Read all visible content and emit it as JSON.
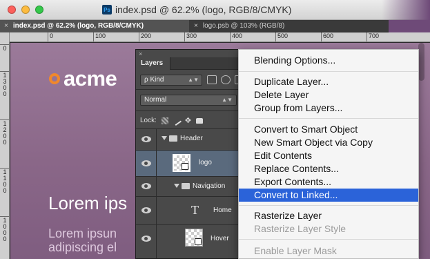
{
  "window": {
    "title": "index.psd @ 62.2% (logo, RGB/8/CMYK)",
    "app_icon": "Ps"
  },
  "tabs": [
    {
      "close": "×",
      "label": "index.psd @ 62.2% (logo, RGB/8/CMYK)",
      "active": true
    },
    {
      "close": "×",
      "label": "logo.psb @ 103% (RGB/8)",
      "active": false
    }
  ],
  "ruler": {
    "top": [
      "0",
      "100",
      "200",
      "300",
      "400",
      "500",
      "600",
      "700"
    ],
    "left": [
      "0",
      "1\n3\n0\n0",
      "1\n2\n0\n0",
      "1\n1\n0\n0",
      "1\n0\n0\n0"
    ]
  },
  "canvas": {
    "logo_text": "acme",
    "hero_title": "Lorem ips",
    "hero_body_line1": "Lorem ipsun",
    "hero_body_line2": "adipiscing el"
  },
  "layers_panel": {
    "close": "×",
    "tab": "Layers",
    "filter_kind": "ρ Kind",
    "blend_mode": "Normal",
    "lock_label": "Lock:",
    "layers": [
      {
        "name": "Header",
        "type": "group",
        "expanded": true
      },
      {
        "name": "logo",
        "type": "smart-object",
        "selected": true
      },
      {
        "name": "Navigation",
        "type": "group",
        "expanded": true
      },
      {
        "name": "Home",
        "type": "text"
      },
      {
        "name": "Hover",
        "type": "smart-object"
      }
    ]
  },
  "context_menu": {
    "items": [
      {
        "label": "Blending Options...",
        "enabled": true
      },
      {
        "label": "Duplicate Layer...",
        "enabled": true
      },
      {
        "label": "Delete Layer",
        "enabled": true
      },
      {
        "label": "Group from Layers...",
        "enabled": true
      },
      {
        "label": "Convert to Smart Object",
        "enabled": true
      },
      {
        "label": "New Smart Object via Copy",
        "enabled": true
      },
      {
        "label": "Edit Contents",
        "enabled": true
      },
      {
        "label": "Replace Contents...",
        "enabled": true
      },
      {
        "label": "Export Contents...",
        "enabled": true
      },
      {
        "label": "Convert to Linked...",
        "enabled": true,
        "highlighted": true
      },
      {
        "label": "Rasterize Layer",
        "enabled": true
      },
      {
        "label": "Rasterize Layer Style",
        "enabled": false
      },
      {
        "label": "Enable Layer Mask",
        "enabled": false
      }
    ]
  },
  "colors": {
    "canvas_bg": "#8d6a8d",
    "logo_accent": "#f0882b",
    "menu_highlight": "#2b63d9",
    "panel_bg": "#494949"
  }
}
